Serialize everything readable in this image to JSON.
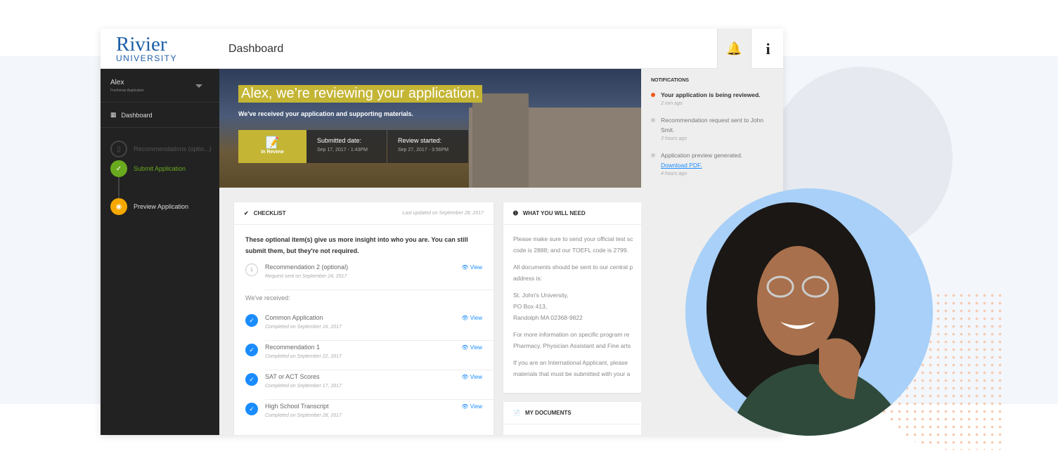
{
  "brand": {
    "name": "Rivier",
    "sub": "UNIVERSITY"
  },
  "header": {
    "title": "Dashboard"
  },
  "sidebar": {
    "user": "Alex",
    "user_sub": "Freshman Application",
    "nav": "Dashboard",
    "steps": [
      "Recommendations (optio...)",
      "Submit Application",
      "Preview Application"
    ]
  },
  "hero": {
    "headline": "Alex, we’re reviewing your application.",
    "subtitle": "We've received your application and supporting materials.",
    "status": "In Review",
    "submitted_label": "Submitted date:",
    "submitted_value": "Sep 17, 2017 - 1:43PM",
    "review_label": "Review started:",
    "review_value": "Sep 27, 2017 - 3:56PM"
  },
  "checklist": {
    "title": "CHECKLIST",
    "updated": "Last updated on September 28, 2017",
    "intro": "These optional item(s) give us more insight into who you are. You can still submit them, but they're not required.",
    "optional": {
      "num": "1",
      "title": "Recommendation 2 (optional)",
      "date": "Request sent on September 24, 2017"
    },
    "received_label": "We've received:",
    "view": "View",
    "items": [
      {
        "title": "Common Application",
        "date": "Completed on September 16, 2017"
      },
      {
        "title": "Recommendation 1",
        "date": "Completed on September 22, 2017"
      },
      {
        "title": "SAT or ACT Scores",
        "date": "Completed on September 17, 2017"
      },
      {
        "title": "High School Transcript",
        "date": "Completed on September 28, 2017"
      }
    ]
  },
  "need": {
    "title": "WHAT YOU WILL NEED",
    "p": [
      "Please make sure to send your official test sc",
      "code is 2888; and our TOEFL code is 2799.",
      "All documents should be sent to our central p",
      "address is:",
      "St. John's University,",
      "PO Box 413,",
      "Randolph MA 02368-9822",
      "For more information on specific program re",
      "Pharmacy, Physician Assistant and Fine arts",
      "If you are an International Applicant, please",
      "materials that must be submitted with your a"
    ]
  },
  "docs": {
    "title": "MY DOCUMENTS"
  },
  "notifications": {
    "title": "NOTIFICATIONS",
    "items": [
      {
        "text": "Your application is being reviewed.",
        "time": "2 min ago"
      },
      {
        "text": "Recommendation request sent to John Smit.",
        "time": "3 hours ago"
      },
      {
        "text": "Application preview generated.",
        "link": "Download PDF.",
        "time": "4 hours ago"
      }
    ]
  },
  "colors": {
    "accent": "#c4b534",
    "blue": "#1a8cff",
    "sidebar": "#222222",
    "green": "#6aaa1e",
    "orange": "#f5a800",
    "alert": "#f05a1a"
  }
}
